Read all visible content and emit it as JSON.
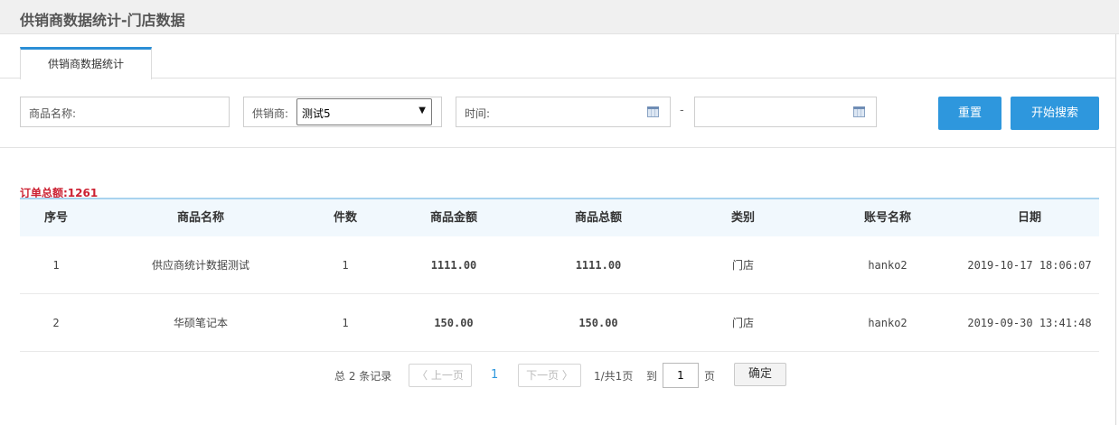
{
  "header": {
    "title": "供销商数据统计-门店数据"
  },
  "tabs": [
    {
      "label": "供销商数据统计"
    }
  ],
  "filters": {
    "product_name_label": "商品名称:",
    "product_name_value": "",
    "supplier_label": "供销商:",
    "supplier_selected": "测试5",
    "time_label": "时间:",
    "time_start": "",
    "time_end": "",
    "range_separator": "-",
    "reset_label": "重置",
    "search_label": "开始搜索"
  },
  "summary": {
    "total_text": "订单总额:1261"
  },
  "table": {
    "columns": [
      "序号",
      "商品名称",
      "件数",
      "商品金额",
      "商品总额",
      "类别",
      "账号名称",
      "日期"
    ],
    "rows": [
      {
        "index": "1",
        "name": "供应商统计数据测试",
        "qty": "1",
        "amount": "1111.00",
        "total": "1111.00",
        "category": "门店",
        "account": "hanko2",
        "date": "2019-10-17 18:06:07"
      },
      {
        "index": "2",
        "name": "华硕笔记本",
        "qty": "1",
        "amount": "150.00",
        "total": "150.00",
        "category": "门店",
        "account": "hanko2",
        "date": "2019-09-30 13:41:48"
      }
    ]
  },
  "pagination": {
    "total_text": "总 2 条记录",
    "prev_label": "〈 上一页",
    "current_page": "1",
    "next_label": "下一页 〉",
    "page_info": "1/共1页",
    "goto_label": "到",
    "goto_value": "1",
    "page_unit": "页",
    "confirm_label": "确定"
  },
  "colors": {
    "accent": "#2e97dd",
    "money": "#cc2233"
  }
}
